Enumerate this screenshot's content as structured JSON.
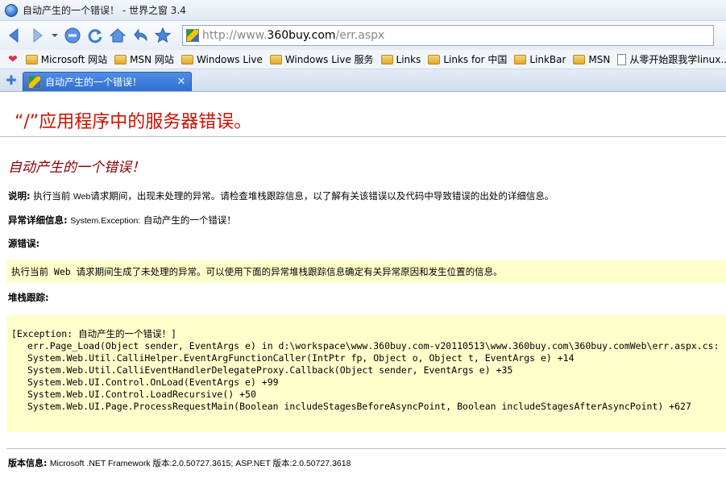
{
  "window": {
    "title": "自动产生的一个错误！ - 世界之窗 3.4"
  },
  "toolbar": {
    "icons": [
      "back-icon",
      "forward-icon",
      "stop-icon",
      "refresh-icon",
      "home-icon",
      "undo-icon",
      "favorite-star-icon"
    ],
    "url_prefix": "http://www.",
    "url_domain": "360buy.com",
    "url_path": "/err.aspx"
  },
  "favorites": {
    "items": [
      {
        "label": "Microsoft 网站",
        "icon": "folder-icon"
      },
      {
        "label": "MSN 网站",
        "icon": "folder-icon"
      },
      {
        "label": "Windows Live",
        "icon": "folder-icon"
      },
      {
        "label": "Windows Live 服务",
        "icon": "folder-icon"
      },
      {
        "label": "Links",
        "icon": "folder-icon"
      },
      {
        "label": "Links for 中国",
        "icon": "folder-icon"
      },
      {
        "label": "LinkBar",
        "icon": "folder-icon"
      },
      {
        "label": "MSN",
        "icon": "folder-icon"
      },
      {
        "label": "从零开始跟我学linux...",
        "icon": "page-icon"
      }
    ]
  },
  "tabs": [
    {
      "label": "自动产生的一个错误！",
      "active": true
    }
  ],
  "page": {
    "heading": "“/”应用程序中的服务器错误。",
    "subheading": "自动产生的一个错误！",
    "description_label": "说明:",
    "description_pre": "执行当前",
    "description_web": "Web",
    "description_post": "请求期间，出现未处理的异常。请检查堆栈跟踪信息，以了解有关该错误以及代码中导致错误的出处的详细信息。",
    "exception_label": "异常详细信息:",
    "exception_type": "System.Exception:",
    "exception_message": "自动产生的一个错误！",
    "source_label": "源错误:",
    "source_text": "执行当前 Web 请求期间生成了未处理的异常。可以使用下面的异常堆栈跟踪信息确定有关异常原因和发生位置的信息。",
    "stack_label": "堆栈跟踪:",
    "stack_header": "[Exception: 自动产生的一个错误！]",
    "stack_lines": [
      "err.Page_Load(Object sender, EventArgs e) in d:\\workspace\\www.360buy.com-v20110513\\www.360buy.com\\360buy.comWeb\\err.aspx.cs:",
      "System.Web.Util.CalliHelper.EventArgFunctionCaller(IntPtr fp, Object o, Object t, EventArgs e) +14",
      "System.Web.Util.CalliEventHandlerDelegateProxy.Callback(Object sender, EventArgs e) +35",
      "System.Web.UI.Control.OnLoad(EventArgs e) +99",
      "System.Web.UI.Control.LoadRecursive() +50",
      "System.Web.UI.Page.ProcessRequestMain(Boolean includeStagesBeforeAsyncPoint, Boolean includeStagesAfterAsyncPoint) +627"
    ],
    "version_label": "版本信息:",
    "version_text": "Microsoft .NET Framework 版本:2.0.50727.3615; ASP.NET 版本:2.0.50727.3618"
  },
  "colors": {
    "heading": "#cc1100",
    "subheading": "#8b0000",
    "code_bg": "#ffffcc"
  }
}
